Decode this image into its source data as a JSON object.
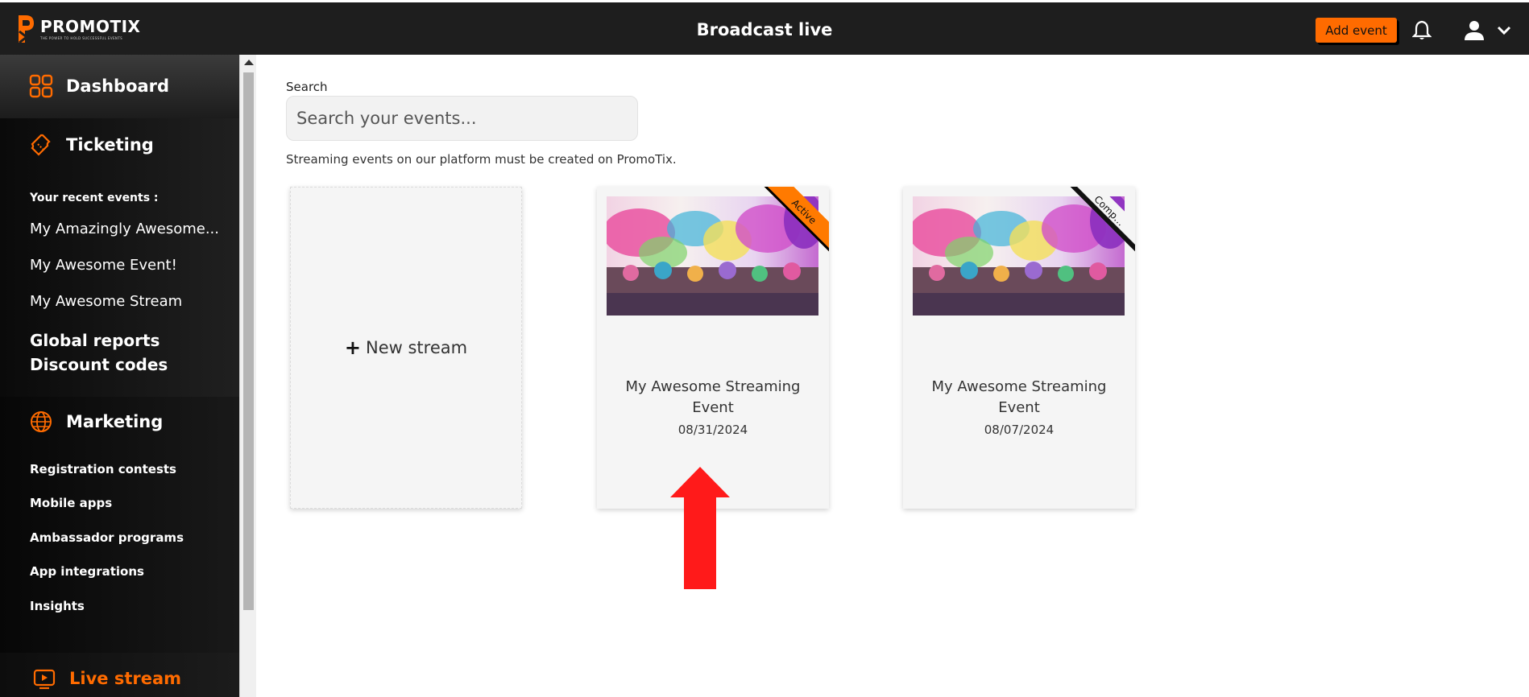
{
  "header": {
    "logo_name": "PROMO",
    "logo_name_accent": "TIX",
    "logo_tagline": "THE POWER TO HOLD SUCCESSFUL EVENTS",
    "title": "Broadcast live",
    "add_event_label": "Add event",
    "icons": [
      "bell-icon",
      "user-icon",
      "chevron-down-icon"
    ]
  },
  "sidebar": {
    "dashboard": "Dashboard",
    "ticketing": "Ticketing",
    "recent_caption": "Your recent events :",
    "recent_events": [
      "My Amazingly Awesome...",
      "My Awesome Event!",
      "My Awesome Stream"
    ],
    "global_reports": "Global reports",
    "discount_codes": "Discount codes",
    "marketing": "Marketing",
    "marketing_items": [
      "Registration contests",
      "Mobile apps",
      "Ambassador programs",
      "App integrations",
      "Insights"
    ],
    "live_stream": "Live stream",
    "accent_color": "#ff6b00"
  },
  "main": {
    "search_label": "Search",
    "search_placeholder": "Search your events...",
    "search_value": "",
    "note": "Streaming events on our platform must be created on PromoTix.",
    "new_stream_label": "New stream",
    "events": [
      {
        "title": "My Awesome Streaming Event",
        "date": "08/31/2024",
        "status": "Active",
        "status_color": "#ff7a00"
      },
      {
        "title": "My Awesome Streaming Event",
        "date": "08/07/2024",
        "status": "Comple...",
        "status_color": "#111111"
      }
    ],
    "annotation_color": "#ff1a1a"
  }
}
